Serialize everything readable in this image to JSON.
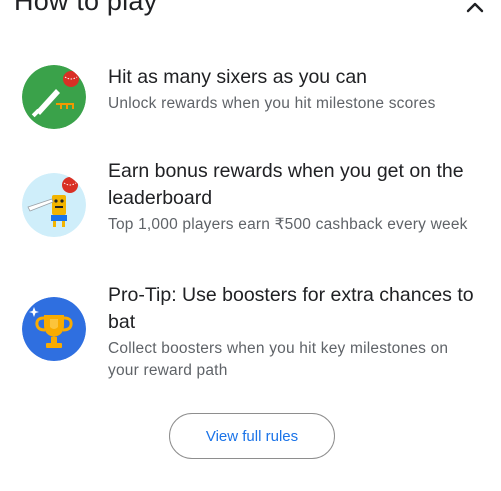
{
  "section": {
    "title": "How to play",
    "collapse_icon": "chevron-up-icon"
  },
  "items": [
    {
      "title": "Hit as many sixers as you can",
      "description": "Unlock rewards when you hit milestone scores",
      "icon": "cricket-bat-ball-icon",
      "icon_bg": "#3aa24a"
    },
    {
      "title": "Earn bonus rewards when you get on the leaderboard",
      "description": "Top 1,000 players earn ₹500 cashback every week",
      "icon": "batter-character-icon",
      "icon_bg": "#cfeefa"
    },
    {
      "title": "Pro-Tip: Use boosters for extra chances to bat",
      "description": "Collect boosters when you hit key milestones on your reward path",
      "icon": "trophy-icon",
      "icon_bg": "#2f6fe0"
    }
  ],
  "button": {
    "label": "View full rules"
  },
  "colors": {
    "link_blue": "#1a73e8",
    "secondary_text": "#5f6368",
    "ball_red": "#d93025"
  }
}
